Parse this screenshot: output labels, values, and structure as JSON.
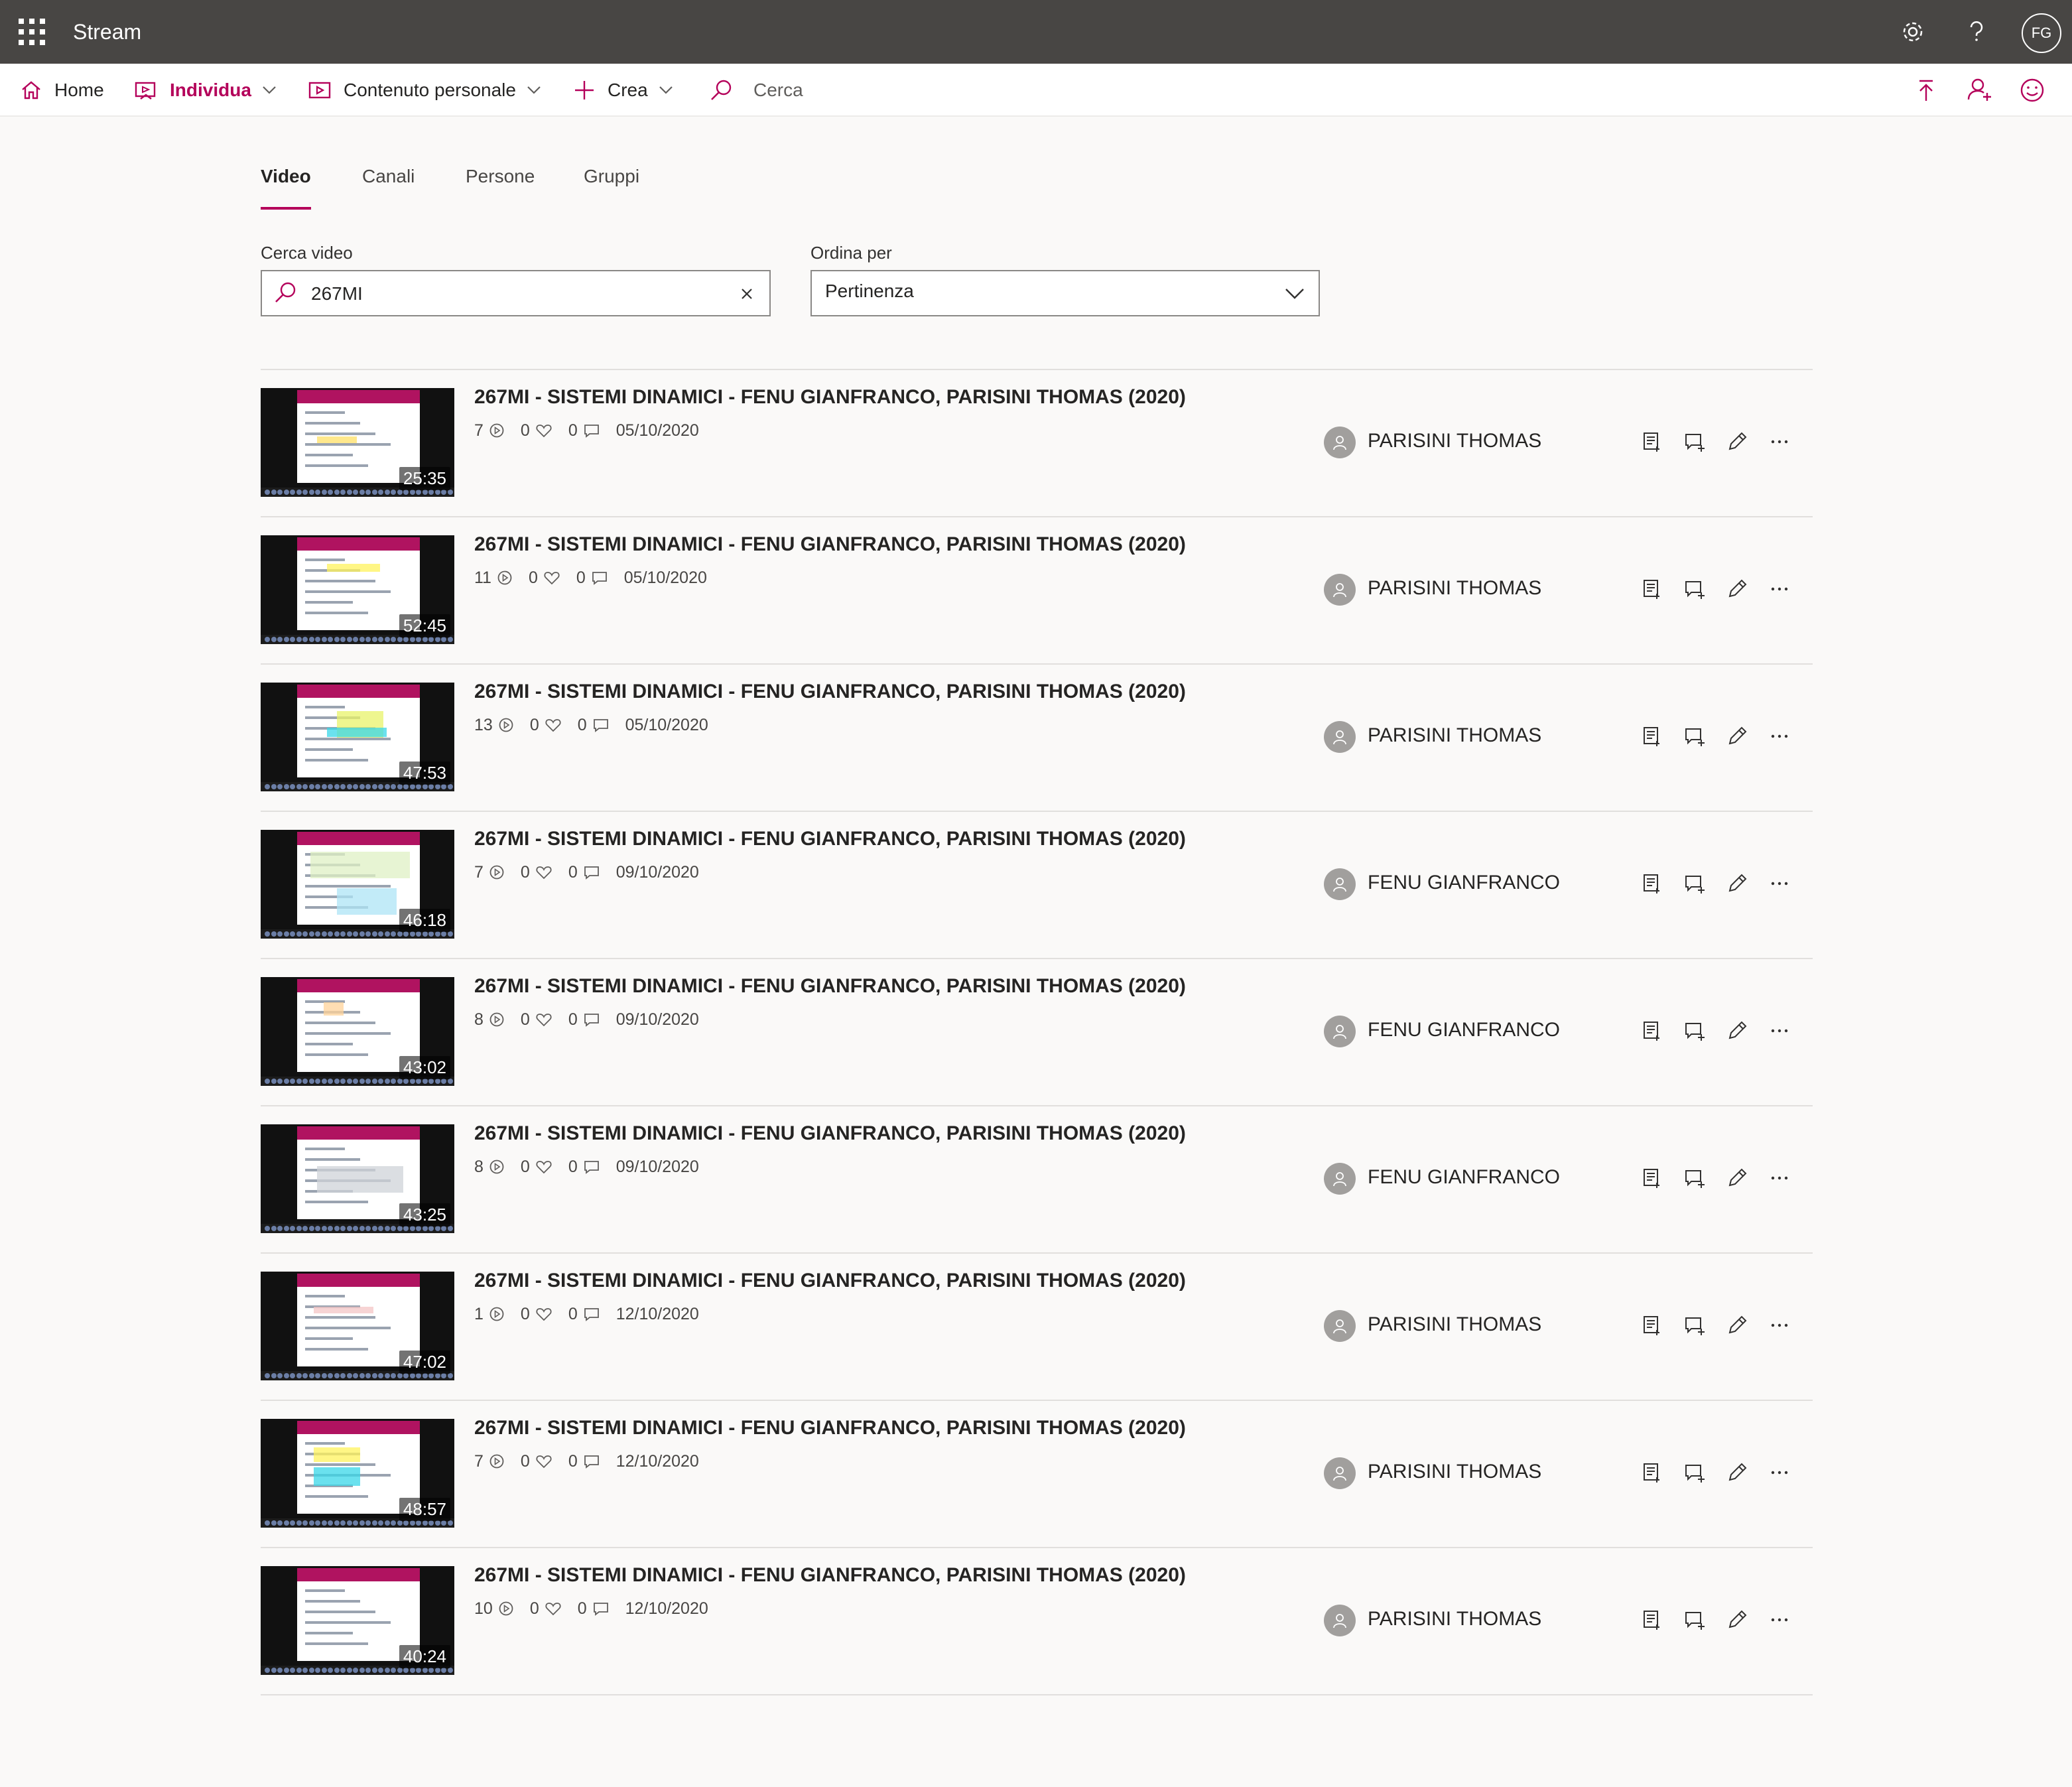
{
  "app": {
    "title": "Stream",
    "user_initials": "FG"
  },
  "icons": {
    "app_launcher": "waffle-icon",
    "settings": "gear-icon",
    "help": "question-icon",
    "home": "home-icon",
    "discover": "discover-icon",
    "my_content": "video-icon",
    "create": "plus-icon",
    "search": "search-icon",
    "upload": "upload-icon",
    "invite": "add-person-icon",
    "feedback": "smiley-icon",
    "views": "play-circle-icon",
    "likes": "heart-icon",
    "comments": "comment-icon",
    "add_to_list": "add-to-watchlist-icon",
    "add_to_group": "add-to-group-icon",
    "edit": "pencil-icon",
    "more": "more-icon"
  },
  "colors": {
    "topbar": "#484644",
    "accent": "#b4005a"
  },
  "nav": {
    "home": "Home",
    "discover": "Individua",
    "my_content": "Contenuto personale",
    "create": "Crea",
    "search_placeholder": "Cerca"
  },
  "tabs": {
    "video": "Video",
    "channels": "Canali",
    "people": "Persone",
    "groups": "Gruppi"
  },
  "filters": {
    "search_label": "Cerca video",
    "search_value": "267MI",
    "sort_label": "Ordina per",
    "sort_value": "Pertinenza"
  },
  "videos": [
    {
      "title": "267MI - SISTEMI DINAMICI - FENU GIANFRANCO, PARISINI THOMAS (2020)",
      "views": "7",
      "likes": "0",
      "comments": "0",
      "date": "05/10/2020",
      "owner": "PARISINI THOMAS",
      "duration": "25:35"
    },
    {
      "title": "267MI - SISTEMI DINAMICI - FENU GIANFRANCO, PARISINI THOMAS (2020)",
      "views": "11",
      "likes": "0",
      "comments": "0",
      "date": "05/10/2020",
      "owner": "PARISINI THOMAS",
      "duration": "52:45"
    },
    {
      "title": "267MI - SISTEMI DINAMICI - FENU GIANFRANCO, PARISINI THOMAS (2020)",
      "views": "13",
      "likes": "0",
      "comments": "0",
      "date": "05/10/2020",
      "owner": "PARISINI THOMAS",
      "duration": "47:53"
    },
    {
      "title": "267MI - SISTEMI DINAMICI - FENU GIANFRANCO, PARISINI THOMAS (2020)",
      "views": "7",
      "likes": "0",
      "comments": "0",
      "date": "09/10/2020",
      "owner": "FENU GIANFRANCO",
      "duration": "46:18"
    },
    {
      "title": "267MI - SISTEMI DINAMICI - FENU GIANFRANCO, PARISINI THOMAS (2020)",
      "views": "8",
      "likes": "0",
      "comments": "0",
      "date": "09/10/2020",
      "owner": "FENU GIANFRANCO",
      "duration": "43:02"
    },
    {
      "title": "267MI - SISTEMI DINAMICI - FENU GIANFRANCO, PARISINI THOMAS (2020)",
      "views": "8",
      "likes": "0",
      "comments": "0",
      "date": "09/10/2020",
      "owner": "FENU GIANFRANCO",
      "duration": "43:25"
    },
    {
      "title": "267MI - SISTEMI DINAMICI - FENU GIANFRANCO, PARISINI THOMAS (2020)",
      "views": "1",
      "likes": "0",
      "comments": "0",
      "date": "12/10/2020",
      "owner": "PARISINI THOMAS",
      "duration": "47:02"
    },
    {
      "title": "267MI - SISTEMI DINAMICI - FENU GIANFRANCO, PARISINI THOMAS (2020)",
      "views": "7",
      "likes": "0",
      "comments": "0",
      "date": "12/10/2020",
      "owner": "PARISINI THOMAS",
      "duration": "48:57"
    },
    {
      "title": "267MI - SISTEMI DINAMICI - FENU GIANFRANCO, PARISINI THOMAS (2020)",
      "views": "10",
      "likes": "0",
      "comments": "0",
      "date": "12/10/2020",
      "owner": "PARISINI THOMAS",
      "duration": "40:24"
    }
  ]
}
